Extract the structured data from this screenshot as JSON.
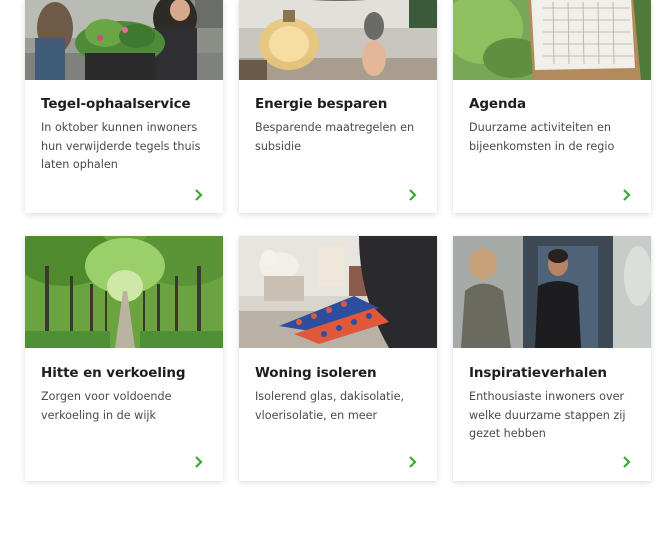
{
  "cards": [
    {
      "title": "Tegel-ophaalservice",
      "description": "In oktober kunnen inwoners hun verwijderde tegels thuis laten ophalen"
    },
    {
      "title": "Energie besparen",
      "description": "Besparende maatregelen en subsidie"
    },
    {
      "title": "Agenda",
      "description": "Duurzame activiteiten en bijeenkomsten in de regio"
    },
    {
      "title": "Hitte en verkoeling",
      "description": "Zorgen voor voldoende verkoeling in de wijk"
    },
    {
      "title": "Woning isoleren",
      "description": "Isolerend glas, dakisolatie, vloerisolatie, en meer"
    },
    {
      "title": "Inspiratieverhalen",
      "description": "Enthousiaste inwoners over welke duurzame stappen zij gezet hebben"
    }
  ],
  "colors": {
    "accent": "#3aa935",
    "title": "#1e1e1e",
    "text": "#4a4a4a"
  },
  "icons": {
    "chevron": "chevron-right-icon"
  }
}
